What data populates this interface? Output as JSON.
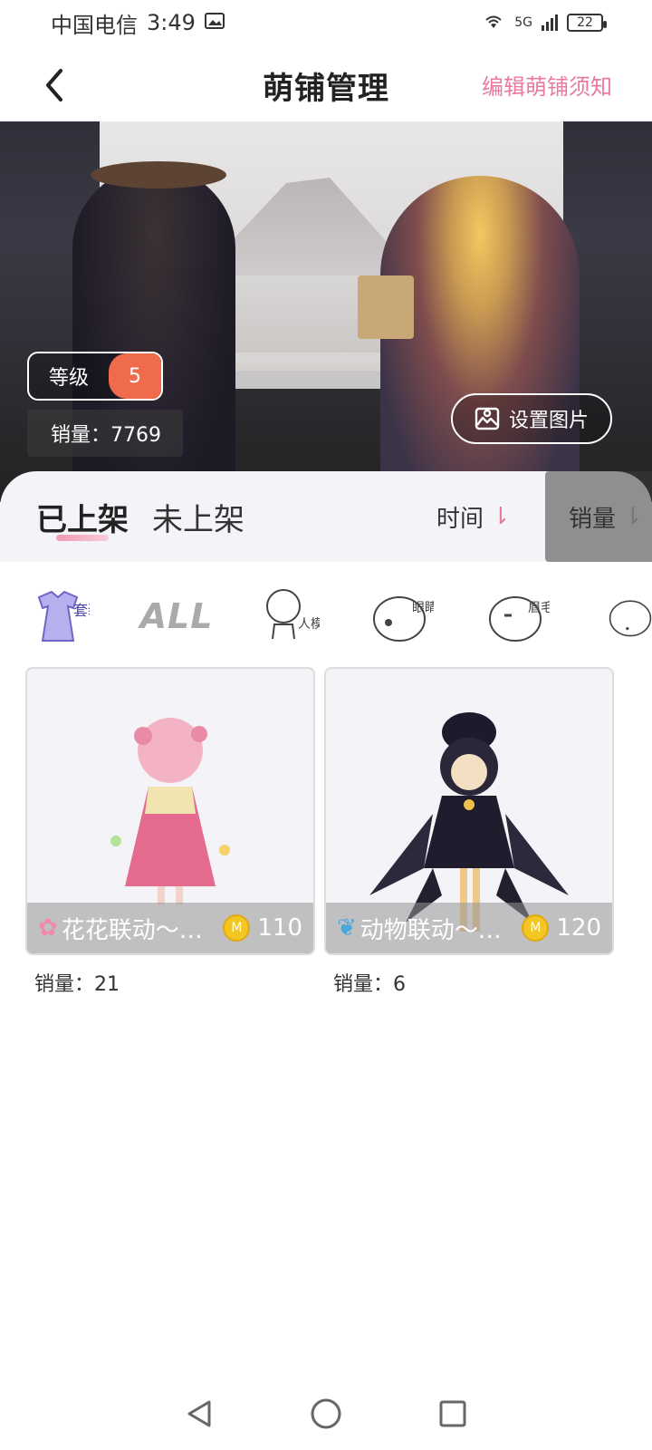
{
  "status_bar": {
    "carrier": "中国电信",
    "time": "3:49",
    "network": "5G",
    "battery": "22"
  },
  "nav": {
    "title": "萌铺管理",
    "action_label": "编辑萌铺须知"
  },
  "banner": {
    "level_label": "等级",
    "level_value": "5",
    "sales_text": "销量：7769",
    "set_image_label": "设置图片"
  },
  "tabs": {
    "listed": "已上架",
    "unlisted": "未上架",
    "sort_time": "时间",
    "sort_sales": "销量"
  },
  "categories": [
    {
      "name": "套装",
      "icon": "outfit-icon"
    },
    {
      "name": "ALL",
      "icon": "all-icon"
    },
    {
      "name": "人模",
      "icon": "model-icon"
    },
    {
      "name": "眼睛",
      "icon": "eyes-icon"
    },
    {
      "name": "眉毛",
      "icon": "eyebrows-icon"
    }
  ],
  "products": [
    {
      "name": "花花联动～…",
      "price": "110",
      "sales": "销量：21",
      "icon": "flower-icon"
    },
    {
      "name": "动物联动～…",
      "price": "120",
      "sales": "销量：6",
      "icon": "bird-icon"
    }
  ],
  "colors": {
    "accent_pink": "#e87b9c",
    "level_orange": "#f06a4c",
    "coin_gold": "#f3c623"
  }
}
